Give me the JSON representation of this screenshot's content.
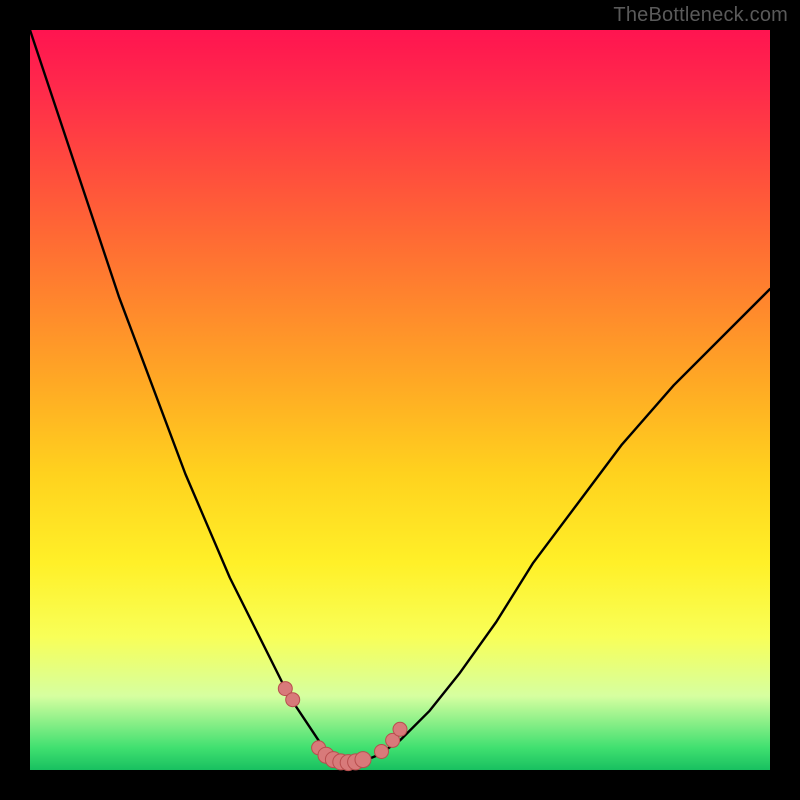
{
  "attribution": "TheBottleneck.com",
  "colors": {
    "curve_stroke": "#000000",
    "marker_fill": "#d87a7a",
    "marker_stroke": "#b84e4e"
  },
  "chart_data": {
    "type": "line",
    "title": "",
    "xlabel": "",
    "ylabel": "",
    "xlim": [
      0,
      100
    ],
    "ylim": [
      0,
      100
    ],
    "x": [
      0,
      3,
      6,
      9,
      12,
      15,
      18,
      21,
      24,
      27,
      30,
      33,
      35,
      37,
      39,
      40,
      41,
      42,
      43,
      45,
      47,
      50,
      54,
      58,
      63,
      68,
      74,
      80,
      87,
      94,
      100
    ],
    "y": [
      100,
      91,
      82,
      73,
      64,
      56,
      48,
      40,
      33,
      26,
      20,
      14,
      10,
      7,
      4,
      2.5,
      1.6,
      1.1,
      1.0,
      1.2,
      2.0,
      4.0,
      8.0,
      13,
      20,
      28,
      36,
      44,
      52,
      59,
      65
    ],
    "markers": {
      "x": [
        34.5,
        35.5,
        39,
        40,
        41,
        42,
        43,
        44,
        45,
        47.5,
        49,
        50
      ],
      "y": [
        11,
        9.5,
        3,
        2,
        1.4,
        1.1,
        1.0,
        1.1,
        1.4,
        2.5,
        4,
        5.5
      ]
    }
  }
}
